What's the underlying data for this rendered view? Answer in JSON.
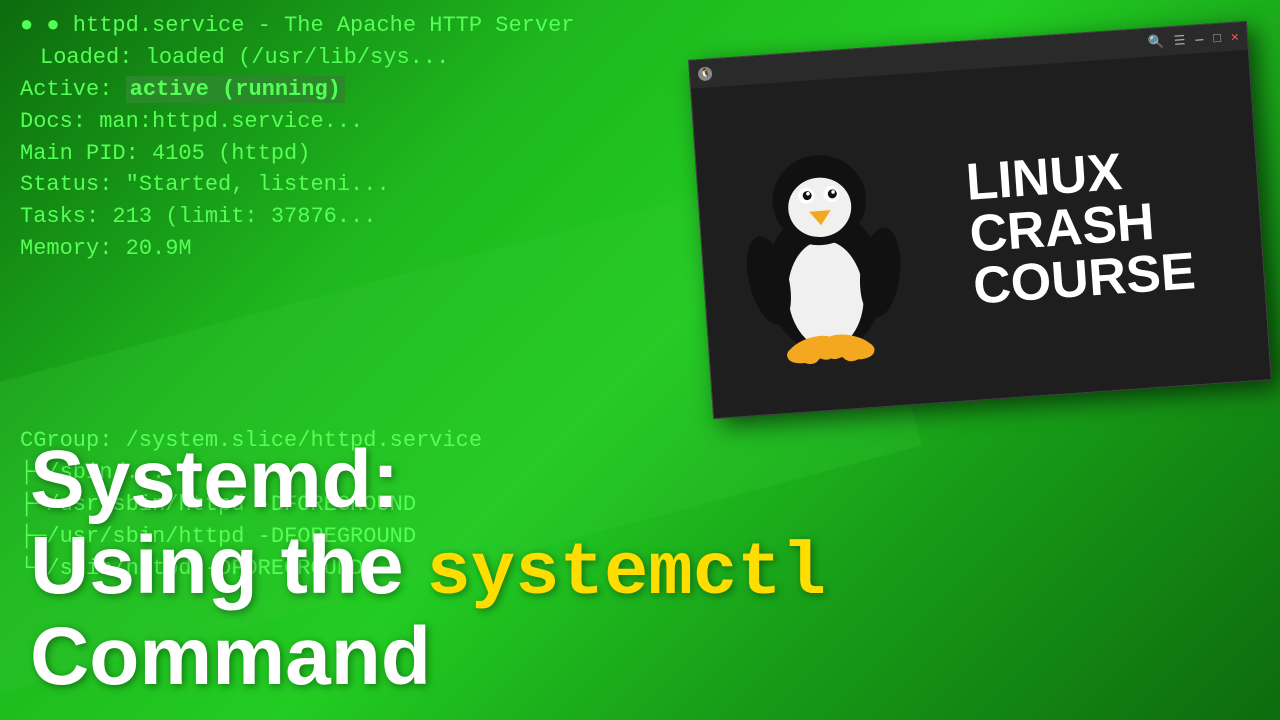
{
  "background": {
    "color_primary": "#1a8a1a",
    "color_secondary": "#22cc22"
  },
  "terminal": {
    "lines": [
      {
        "text": "● httpd.service - The Apache HTTP Server",
        "type": "header"
      },
      {
        "label": "   Loaded:",
        "value": " loaded (/usr/lib/sys...",
        "type": "info"
      },
      {
        "label": "   Active:",
        "value": " active (running)",
        "type": "active"
      },
      {
        "label": "     Docs:",
        "value": " man:httpd.service...",
        "type": "info"
      },
      {
        "label": " Main PID:",
        "value": " 4105 (httpd)",
        "type": "info"
      },
      {
        "label": "   Status:",
        "value": " \"Started, listeni...",
        "type": "info"
      },
      {
        "label": "    Tasks:",
        "value": " 213 (limit: 37876...",
        "type": "info"
      },
      {
        "label": "   Memory:",
        "value": " 20.9M",
        "type": "info"
      },
      {
        "label": "    CGroup:",
        "value": " /system.slice/httpd.service",
        "type": "info"
      },
      {
        "text": "           ├─/sbin/... ",
        "type": "plain"
      },
      {
        "text": "           ├─/usr/sbin/httpd -DFOREGROUND",
        "type": "plain"
      },
      {
        "text": "           ├─/usr/sbin/httpd -DFOREGROUND",
        "type": "plain"
      },
      {
        "text": "           └─/sbin/httpd -DFOREGROUND",
        "type": "plain"
      }
    ]
  },
  "overlay": {
    "line1": "Systemd:",
    "line2_prefix": "Using the ",
    "line2_highlight": "systemctl",
    "line3": "Command"
  },
  "lcc_panel": {
    "title_line1": "LINUX",
    "title_line2": "CRASH",
    "title_line3": "COURSE",
    "window_title": ""
  },
  "icons": {
    "search": "🔍",
    "menu": "☰",
    "minimize": "—",
    "maximize": "□",
    "close": "✕"
  }
}
